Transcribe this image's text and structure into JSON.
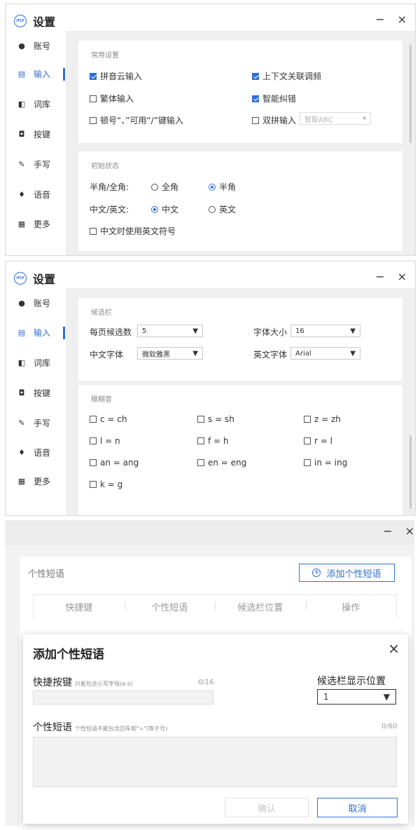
{
  "window": {
    "title": "设置",
    "logo_text": "iFLY",
    "minimize": "−",
    "close": "×"
  },
  "sidebar": {
    "items": [
      {
        "label": "账号",
        "icon": "person-icon"
      },
      {
        "label": "输入",
        "icon": "keyboard-icon"
      },
      {
        "label": "词库",
        "icon": "dictionary-icon"
      },
      {
        "label": "按键",
        "icon": "key-icon"
      },
      {
        "label": "手写",
        "icon": "pen-icon"
      },
      {
        "label": "语音",
        "icon": "microphone-icon"
      },
      {
        "label": "更多",
        "icon": "grid-icon"
      }
    ],
    "active": "输入"
  },
  "panel1": {
    "common": {
      "title": "常用设置",
      "pinyin_cloud": {
        "label": "拼音云输入",
        "checked": true
      },
      "context_freq": {
        "label": "上下文关联调频",
        "checked": true
      },
      "traditional": {
        "label": "繁体输入",
        "checked": false
      },
      "smart_correct": {
        "label": "智能纠错",
        "checked": true
      },
      "punct": {
        "label": "顿号“、”可用“/”键输入",
        "checked": false
      },
      "shuangpin": {
        "label": "双拼输入",
        "checked": false,
        "select_value": "智能ABC"
      }
    },
    "initial": {
      "title": "初始状态",
      "width_label": "半角/全角:",
      "full_width": "全角",
      "half_width": "半角",
      "width_selected": "半角",
      "lang_label": "中文/英文:",
      "chinese": "中文",
      "english": "英文",
      "lang_selected": "中文",
      "use_en_symbols": {
        "label": "中文时使用英文符号",
        "checked": false
      }
    }
  },
  "panel2": {
    "candidate": {
      "title": "候选栏",
      "per_page_label": "每页候选数",
      "per_page_value": "5",
      "font_size_label": "字体大小",
      "font_size_value": "16",
      "cn_font_label": "中文字体",
      "cn_font_value": "微软雅黑",
      "en_font_label": "英文字体",
      "en_font_value": "Arial"
    },
    "fuzzy": {
      "title": "模糊音",
      "options": [
        "c = ch",
        "s = sh",
        "z = zh",
        "l = n",
        "f = h",
        "r = l",
        "an = ang",
        "en = eng",
        "in = ing",
        "k = g"
      ]
    }
  },
  "panel3": {
    "section_title": "个性短语",
    "add_button": "添加个性短语",
    "columns": [
      "快捷键",
      "个性短语",
      "候选栏位置",
      "操作"
    ],
    "dialog": {
      "title": "添加个性短语",
      "close": "×",
      "shortcut_label": "快捷按键",
      "shortcut_hint": "只能包含小写字母(a-z)",
      "shortcut_counter": "0/16",
      "position_label": "候选栏显示位置",
      "position_value": "1",
      "phrase_label": "个性短语",
      "phrase_hint": "个性短语不能包含回车和\"=\"(等于号)",
      "phrase_counter": "0/60",
      "confirm": "确认",
      "cancel": "取消"
    }
  },
  "colors": {
    "accent": "#2f6fd8",
    "content_bg": "#efefef"
  }
}
